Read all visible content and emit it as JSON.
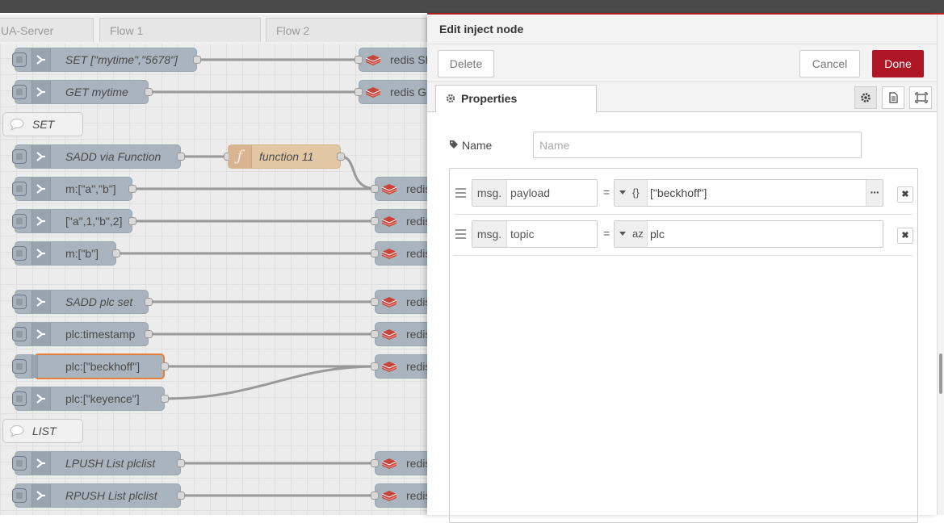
{
  "workspace": {
    "tabs": [
      "UA-Server",
      "Flow 1",
      "Flow 2"
    ],
    "nodes": {
      "set_mytime": "SET [\"mytime\",\"5678\"]",
      "get_mytime": "GET mytime",
      "comment_set": "SET",
      "sadd_via_function": "SADD via Function",
      "function11": "function 11",
      "m_ab": "m:[\"a\",\"b\"]",
      "a1b2": "[\"a\",1,\"b\",2]",
      "m_b": "m:[\"b\"]",
      "sadd_plc_set": "SADD plc set",
      "plc_timestamp": "plc:timestamp",
      "plc_beckhoff": "plc:[\"beckhoff\"]",
      "plc_keyence": "plc:[\"keyence\"]",
      "comment_list": "LIST",
      "lpush": "LPUSH List plclist",
      "rpush": "RPUSH List plclist",
      "redis_set": "redis SET",
      "redis_get": "redis GET",
      "redis_short": "redis"
    }
  },
  "tray": {
    "title": "Edit inject node",
    "delete_label": "Delete",
    "cancel_label": "Cancel",
    "done_label": "Done",
    "tab_properties": "Properties",
    "name_label": "Name",
    "name_placeholder": "Name",
    "name_value": "",
    "rows": [
      {
        "prefix": "msg.",
        "property": "payload",
        "equals": "=",
        "type_glyph": "{}",
        "value": "[\"beckhoff\"]"
      },
      {
        "prefix": "msg.",
        "property": "topic",
        "equals": "=",
        "type_glyph": "az",
        "value": "plc"
      }
    ]
  },
  "colors": {
    "accent_red": "#ad1625",
    "inject_node": "#a9b4bf",
    "function_node": "#e3c6a4",
    "redis_icon": "#c8453a",
    "selected_outline": "#e87e3a"
  }
}
